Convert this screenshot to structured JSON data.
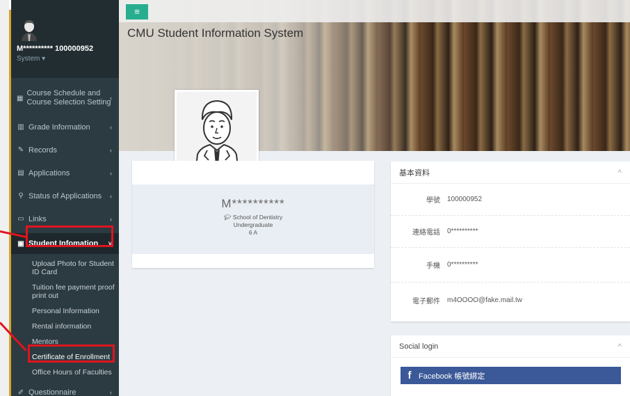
{
  "app": {
    "title": "CMU Student Information System",
    "menu_toggle": "≡"
  },
  "user": {
    "name": "M**********   100000952",
    "role": "System ▾"
  },
  "sidebar": {
    "items": [
      {
        "label": "Course Schedule and Course Selection Setting",
        "icon": "calendar-icon",
        "glyph": "▦"
      },
      {
        "label": "Grade Information",
        "icon": "bar-chart-icon",
        "glyph": "▥"
      },
      {
        "label": "Records",
        "icon": "edit-icon",
        "glyph": "✎"
      },
      {
        "label": "Applications",
        "icon": "document-icon",
        "glyph": "▤"
      },
      {
        "label": "Status of Applications",
        "icon": "search-icon",
        "glyph": "⚲"
      },
      {
        "label": "Links",
        "icon": "monitor-icon",
        "glyph": "▭"
      },
      {
        "label": "Student Infomation",
        "icon": "card-icon",
        "glyph": "▣"
      }
    ],
    "sub_items": [
      "Upload Photo for Student ID Card",
      "Tuition fee payment proof print out",
      "Personal Information",
      "Rental information",
      "Mentors",
      "Certificate of Enrollment",
      "Office Hours of Faculties"
    ],
    "last_item": {
      "label": "Questionnaire",
      "icon": "pencil-icon",
      "glyph": "✐"
    },
    "chevron": "‹",
    "chevron_open": "˅"
  },
  "profile": {
    "name": "M**********",
    "school": "School of Dentistry",
    "level": "Undergraduate",
    "class": "6 A"
  },
  "basic_info": {
    "title": "基本資料",
    "rows": [
      {
        "key": "學號",
        "value": "100000952"
      },
      {
        "key": "連絡電話",
        "value": "0**********"
      },
      {
        "key": "手機",
        "value": "0**********"
      },
      {
        "key": "電子郵件",
        "value": "m4OOOO@fake.mail.tw"
      }
    ]
  },
  "social": {
    "title": "Social login",
    "facebook_label": "Facebook 帳號綁定"
  },
  "colors": {
    "sidebar": "#2c3b41",
    "accent": "#27ae8f",
    "annotation": "#e0141e",
    "facebook": "#3b5998"
  }
}
